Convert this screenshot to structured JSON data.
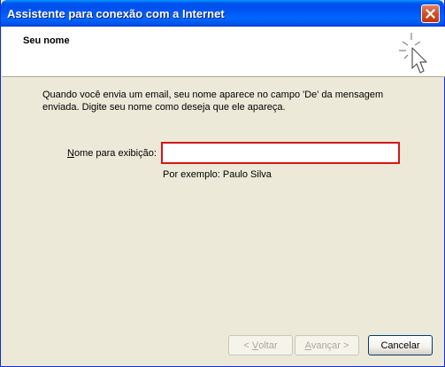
{
  "window": {
    "title": "Assistente para conexão com a Internet"
  },
  "header": {
    "title": "Seu nome"
  },
  "body": {
    "description": "Quando você envia um email, seu nome aparece no campo 'De' da mensagem enviada. Digite seu nome como deseja que ele apareça.",
    "field_label_mnemonic": "N",
    "field_label_rest": "ome para exibição:",
    "field_value": "",
    "example": "Por exemplo: Paulo Silva"
  },
  "buttons": {
    "back_mnemonic": "V",
    "back_rest": "oltar",
    "next_mnemonic": "A",
    "next_rest": "vançar",
    "cancel": "Cancelar"
  },
  "colors": {
    "titlebar": "#0054e3",
    "dialog_background": "#ece9d8",
    "input_border_highlight": "#d21818"
  },
  "icons": [
    "close-icon",
    "wizard-cursor-icon"
  ]
}
